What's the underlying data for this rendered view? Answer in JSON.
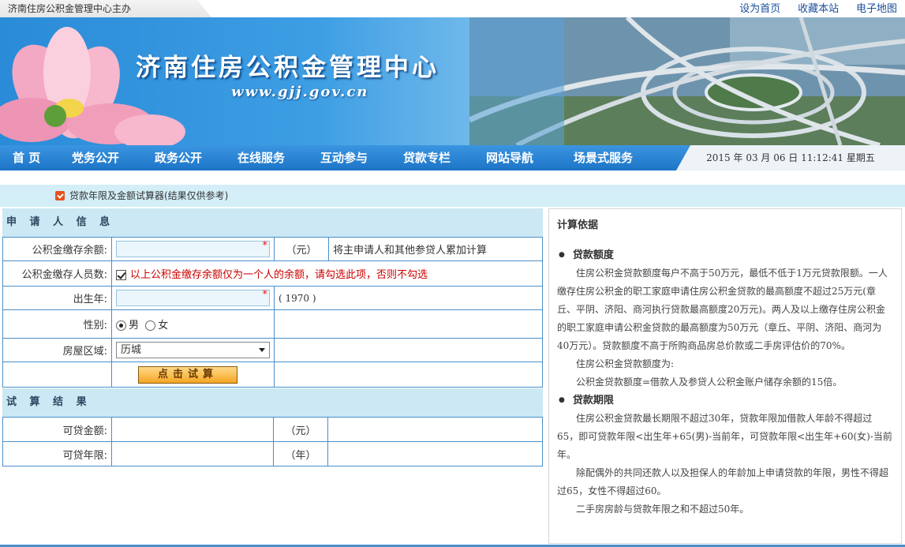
{
  "topbar": {
    "host": "济南住房公积金管理中心主办",
    "links": [
      "设为首页",
      "收藏本站",
      "电子地图"
    ]
  },
  "banner": {
    "title": "济南住房公积金管理中心",
    "url": "www.gjj.gov.cn"
  },
  "nav": {
    "items": [
      "首 页",
      "党务公开",
      "政务公开",
      "在线服务",
      "互动参与",
      "贷款专栏",
      "网站导航",
      "场景式服务"
    ],
    "datetime": "2015 年  03 月  06 日  11:12:41 星期五"
  },
  "page": {
    "title": "贷款年限及金额试算器(结果仅供参考)"
  },
  "applicant": {
    "heading": "申 请 人 信 息",
    "balance_label": "公积金缴存余额:",
    "balance_value": "",
    "balance_required": "*",
    "balance_unit": "（元）",
    "balance_note": "将主申请人和其他参贷人累加计算",
    "count_label": "公积金缴存人员数:",
    "count_note": "以上公积金缴存余额仅为一个人的余额，请勾选此项，否则不勾选",
    "birth_label": "出生年:",
    "birth_value": "",
    "birth_required": "*",
    "birth_hint": "( 1970 )",
    "gender_label": "性别:",
    "gender_male": "男",
    "gender_female": "女",
    "area_label": "房屋区域:",
    "area_value": "历城",
    "submit_label": "点击试算"
  },
  "result": {
    "heading": "试 算 结 果",
    "amount_label": "可贷金额:",
    "amount_unit": "（元）",
    "years_label": "可贷年限:",
    "years_unit": "（年）"
  },
  "info": {
    "heading": "计算依据",
    "section1": "贷款额度",
    "p1": "住房公积金贷款额度每户不高于50万元，最低不低于1万元贷款限额。一人缴存住房公积金的职工家庭申请住房公积金贷款的最高额度不超过25万元(章丘、平阴、济阳、商河执行贷款最高额度20万元)。两人及以上缴存住房公积金的职工家庭申请公积金贷款的最高额度为50万元（章丘、平阴、济阳、商河为40万元）。贷款额度不高于所购商品房总价款或二手房评估价的70%。",
    "p2": "住房公积金贷款额度为:",
    "p3": "公积金贷款额度=借款人及参贷人公积金账户储存余额的15倍。",
    "section2": "贷款期限",
    "p4": "住房公积金贷款最长期限不超过30年，贷款年限加借款人年龄不得超过65，即可贷款年限<出生年+65(男)-当前年，可贷款年限<出生年+60(女)-当前年。",
    "p5": "除配偶外的共同还款人以及担保人的年龄加上申请贷款的年限，男性不得超过65，女性不得超过60。",
    "p6": "二手房房龄与贷款年限之和不超过50年。"
  },
  "colors": {
    "nav_blue": "#1d74c7",
    "section_bg": "#cbe8f4",
    "border_blue": "#4a8fc9",
    "note_red": "#cc0000",
    "button_orange": "#f5a623"
  }
}
